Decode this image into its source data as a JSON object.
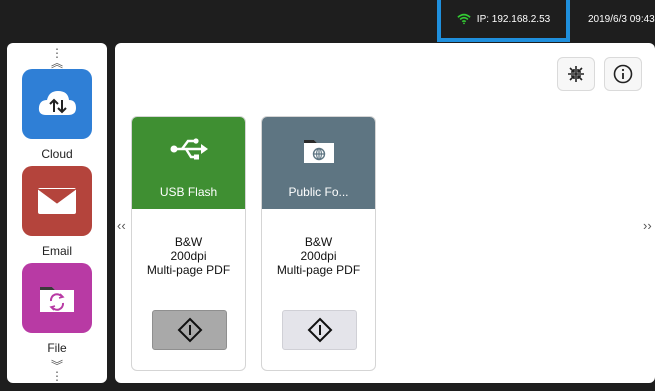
{
  "status_bar": {
    "ip_text": "IP: 192.168.2.53",
    "datetime": "2019/6/3 09:43",
    "highlight_color": "#1f8fdc",
    "wifi_color": "#33cc33"
  },
  "sidebar": {
    "items": [
      {
        "label": "Cloud",
        "icon": "cloud-upload-icon",
        "color": "#2f7fd6"
      },
      {
        "label": "Email",
        "icon": "envelope-icon",
        "color": "#b4443c"
      },
      {
        "label": "File",
        "icon": "folder-sync-icon",
        "color": "#b83aa4"
      }
    ]
  },
  "toolbar": {
    "collapse_icon": "collapse-icon",
    "info_icon": "info-icon"
  },
  "cards": [
    {
      "title": "USB Flash",
      "icon": "usb-icon",
      "header_color": "#3f8f32",
      "color_mode": "B&W",
      "resolution": "200dpi",
      "format": "Multi-page PDF",
      "start_active": true
    },
    {
      "title": "Public Fo...",
      "icon": "network-folder-icon",
      "header_color": "#5e7582",
      "color_mode": "B&W",
      "resolution": "200dpi",
      "format": "Multi-page PDF",
      "start_active": false
    }
  ]
}
